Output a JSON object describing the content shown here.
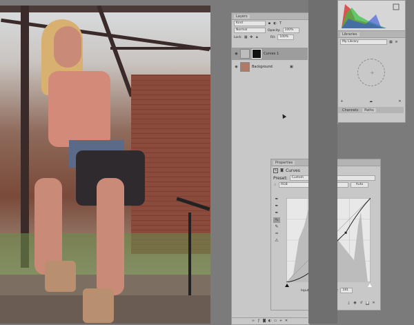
{
  "layers_panel": {
    "tab": "Layers",
    "kind_filter": "Kind",
    "blend_mode": "Normal",
    "opacity_label": "Opacity:",
    "opacity_value": "100%",
    "lock_label": "Lock:",
    "fill_label": "Fill:",
    "fill_value": "100%",
    "layers": [
      {
        "name": "Curves 1",
        "selected": true
      },
      {
        "name": "Background",
        "selected": false
      }
    ]
  },
  "libraries_panel": {
    "tab": "Libraries",
    "library_select": "My Library",
    "bottom_tabs": [
      "Channels",
      "Paths"
    ]
  },
  "properties_panel": {
    "tab": "Properties",
    "adjustment_title": "Curves",
    "preset_label": "Preset:",
    "preset_value": "Custom",
    "channel_value": "RGB",
    "auto_label": "Auto",
    "input_label": "Input:",
    "input_value": "198",
    "output_label": "Output:",
    "output_value": "181",
    "curve_points": [
      [
        0,
        0
      ],
      [
        90,
        45
      ],
      [
        180,
        150
      ],
      [
        255,
        255
      ]
    ]
  },
  "colors": {
    "panel_bg": "#c8c8c8",
    "workspace_bg": "#7b7b7b",
    "histogram": [
      "#e03030",
      "#30c040",
      "#3050e0"
    ]
  },
  "icons": [
    "eye-icon",
    "lock-icon",
    "link-icon",
    "fx-icon",
    "trash-icon",
    "new-layer-icon",
    "folder-icon",
    "eyedropper-icon",
    "pencil-icon",
    "hand-icon",
    "reset-icon",
    "visibility-icon"
  ]
}
